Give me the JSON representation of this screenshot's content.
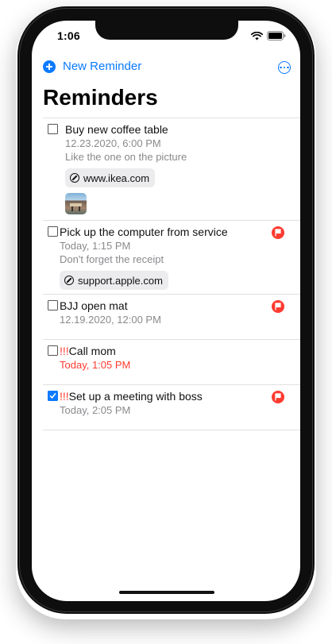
{
  "status_bar": {
    "time": "1:06",
    "wifi_icon": "wifi-icon",
    "battery_icon": "battery-icon"
  },
  "toolbar": {
    "new_reminder_label": "New Reminder",
    "new_reminder_icon": "plus-circle-icon",
    "more_icon": "ellipsis-circle-icon"
  },
  "page": {
    "title": "Reminders"
  },
  "colors": {
    "accent": "#0a7aff",
    "flag": "#ff3b30",
    "priority": "#ff3b30",
    "secondary_text": "#8a8a8e"
  },
  "reminders": [
    {
      "completed": false,
      "priority": "",
      "title": "Buy new coffee table",
      "date": "12.23.2020, 6:00 PM",
      "note": "Like the one on the picture",
      "link": "www.ikea.com",
      "has_image": true,
      "flagged": false
    },
    {
      "completed": false,
      "priority": "",
      "title": "Pick up the computer from service",
      "date": "Today, 1:15 PM",
      "note": "Don't forget the receipt",
      "link": "support.apple.com",
      "flagged": true
    },
    {
      "completed": false,
      "priority": "",
      "title": "BJJ open mat",
      "date": "12.19.2020, 12:00 PM",
      "flagged": true
    },
    {
      "completed": false,
      "priority": "!!!",
      "title": "Call mom",
      "date": "Today, 1:05 PM",
      "overdue": true,
      "flagged": false
    },
    {
      "completed": true,
      "priority": "!!!",
      "title": "Set up a meeting with boss",
      "date": "Today, 2:05 PM",
      "flagged": true
    }
  ]
}
